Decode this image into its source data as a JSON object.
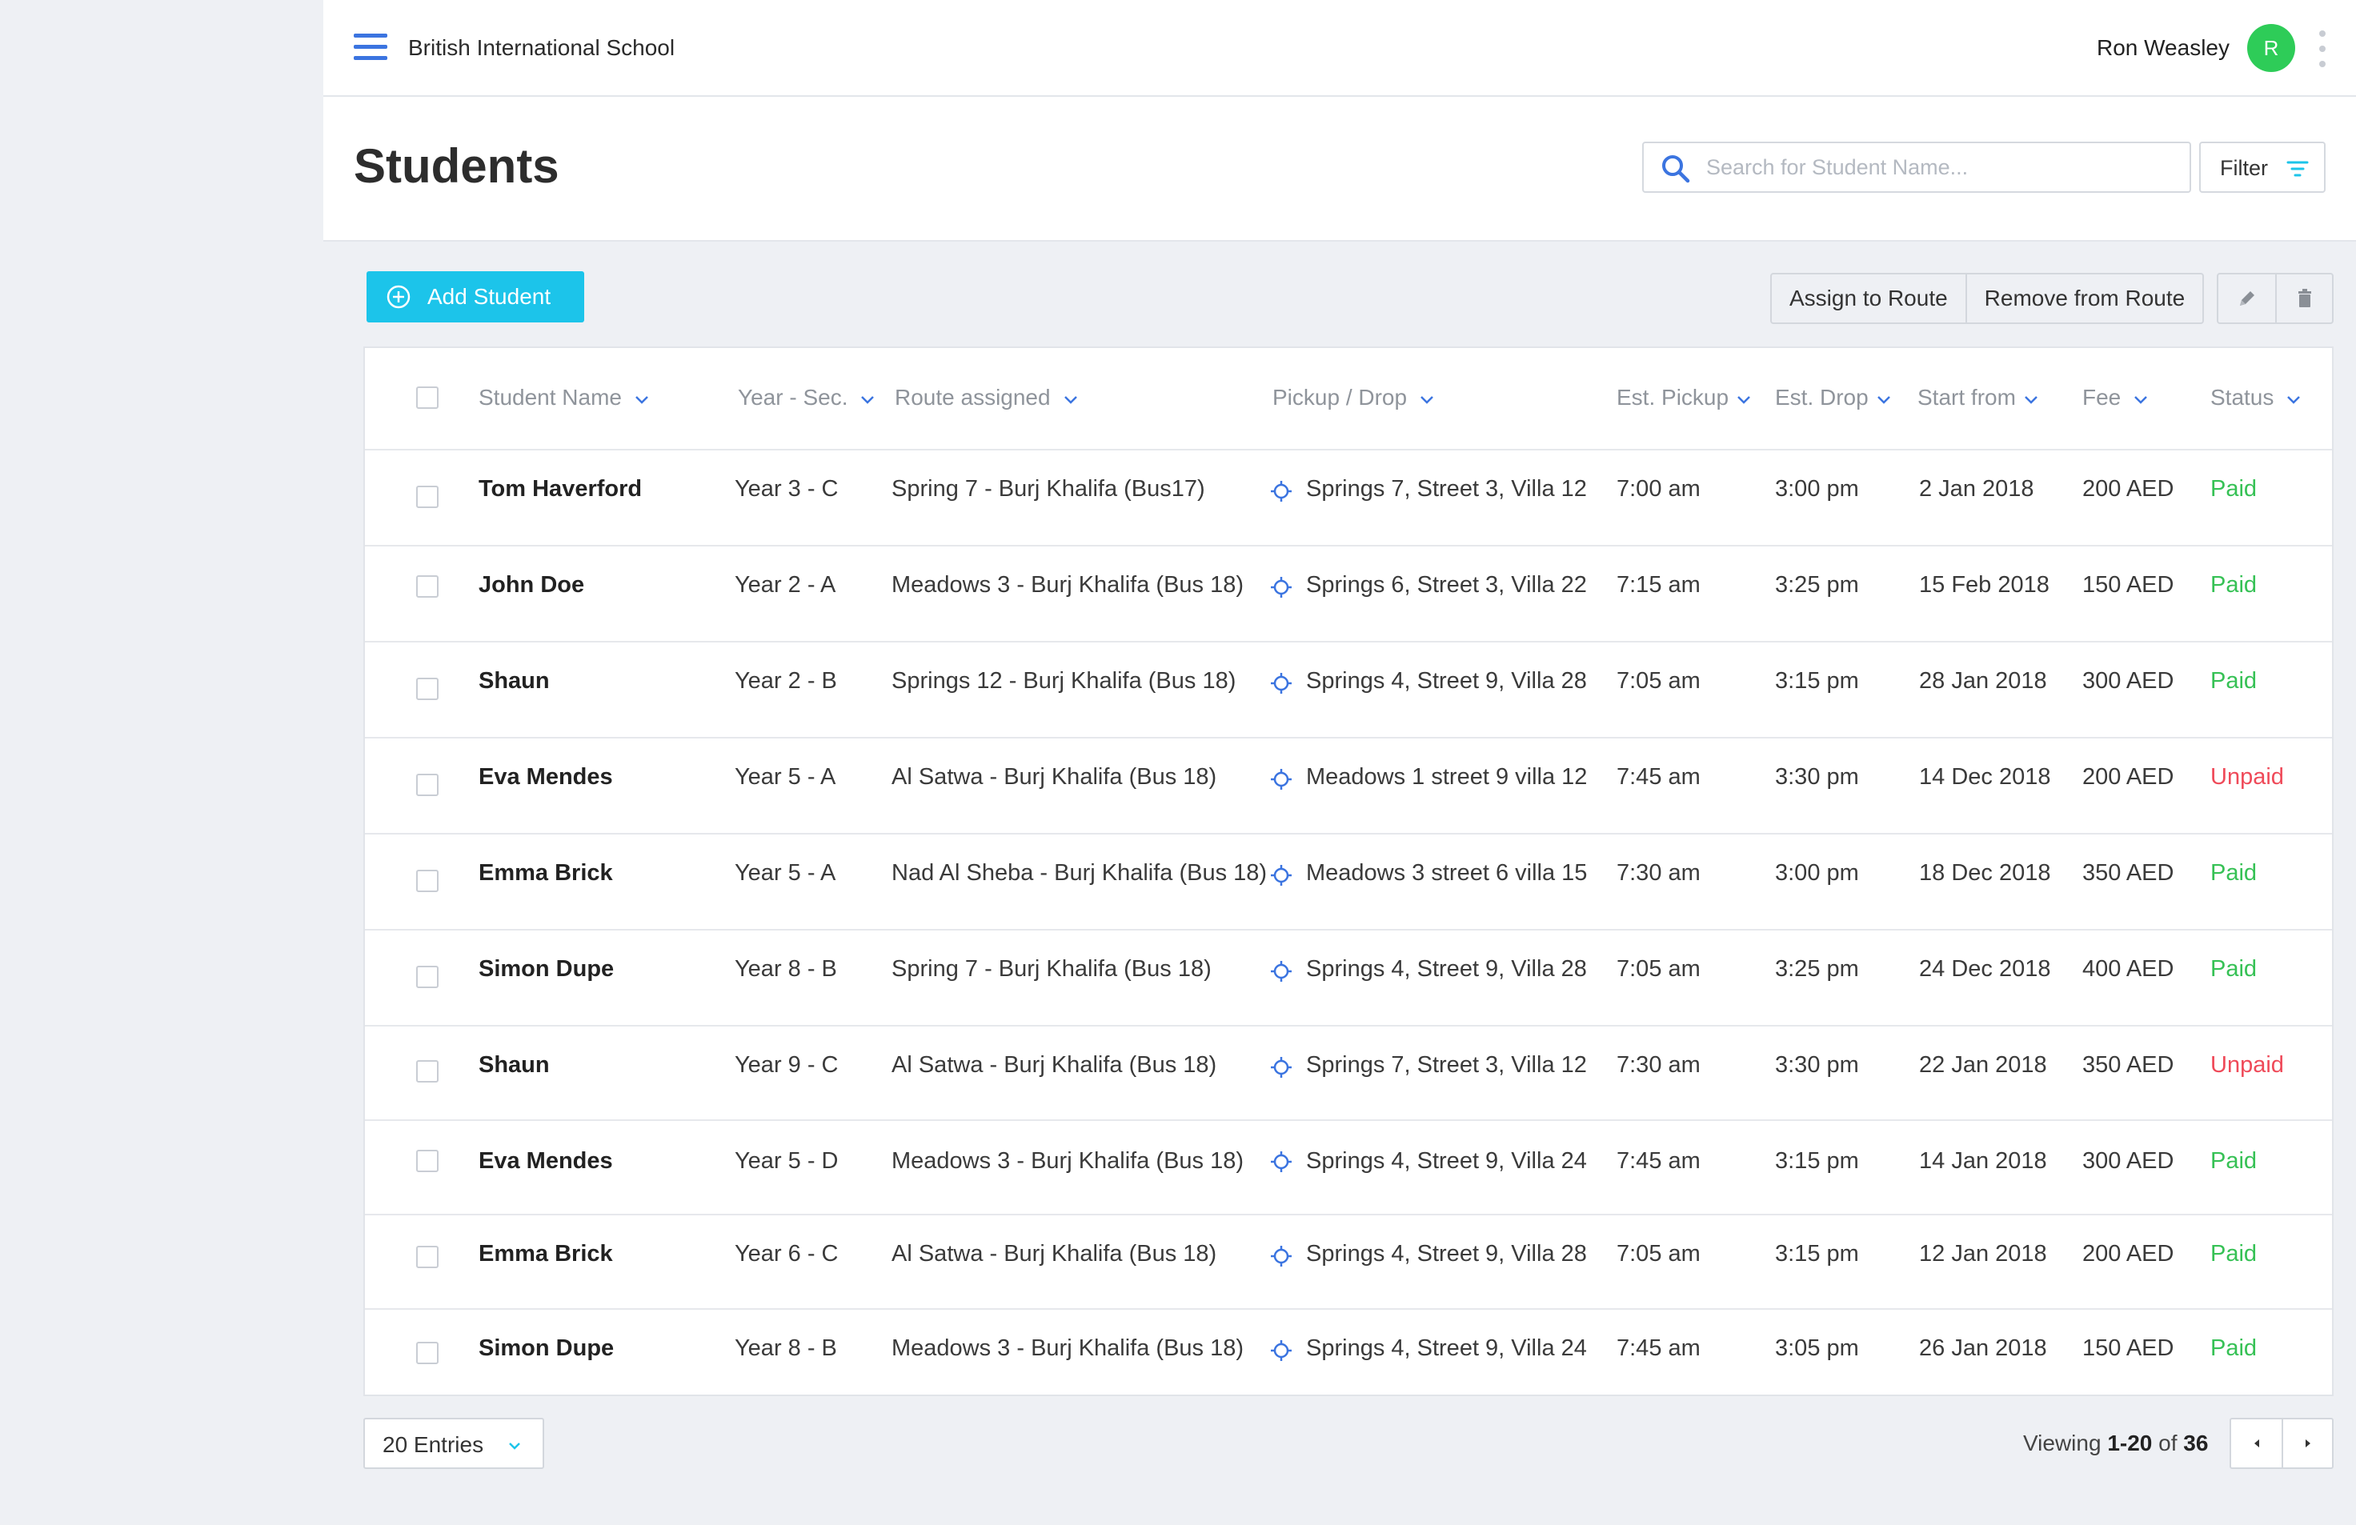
{
  "app": {
    "school_name": "British International School",
    "user_name": "Ron Weasley",
    "user_initial": "R",
    "accent_color": "#3b74e0",
    "avatar_color": "#2ecc58"
  },
  "header": {
    "title": "Students",
    "search_placeholder": "Search for Student Name...",
    "search_value": "",
    "filter_label": "Filter"
  },
  "toolbar": {
    "add_label": "Add Student",
    "add_color": "#1cc4ea",
    "assign_label": "Assign to Route",
    "remove_label": "Remove from Route",
    "edit_icon": "pencil-icon",
    "delete_icon": "trash-icon"
  },
  "table": {
    "columns": [
      "Student Name",
      "Year - Sec.",
      "Route assigned",
      "Pickup / Drop",
      "Est. Pickup",
      "Est. Drop",
      "Start from",
      "Fee",
      "Status"
    ],
    "rows": [
      {
        "name": "Tom Haverford",
        "year": "Year 3 - C",
        "route": "Spring 7 - Burj Khalifa (Bus17)",
        "pickup": "Springs 7, Street 3, Villa 12",
        "est_pickup": "7:00 am",
        "est_drop": "3:00 pm",
        "start": "2 Jan 2018",
        "fee": "200 AED",
        "status": "Paid"
      },
      {
        "name": "John Doe",
        "year": "Year 2 - A",
        "route": "Meadows 3 - Burj Khalifa (Bus 18)",
        "pickup": "Springs 6, Street 3, Villa 22",
        "est_pickup": "7:15 am",
        "est_drop": "3:25 pm",
        "start": "15 Feb 2018",
        "fee": "150 AED",
        "status": "Paid"
      },
      {
        "name": "Shaun",
        "year": "Year 2 - B",
        "route": "Springs 12 - Burj Khalifa (Bus 18)",
        "pickup": "Springs 4, Street 9, Villa 28",
        "est_pickup": "7:05 am",
        "est_drop": "3:15 pm",
        "start": "28 Jan 2018",
        "fee": "300 AED",
        "status": "Paid"
      },
      {
        "name": "Eva Mendes",
        "year": "Year 5 - A",
        "route": "Al Satwa - Burj Khalifa (Bus 18)",
        "pickup": "Meadows 1 street 9 villa 12",
        "est_pickup": "7:45 am",
        "est_drop": "3:30 pm",
        "start": "14 Dec 2018",
        "fee": "200 AED",
        "status": "Unpaid"
      },
      {
        "name": "Emma Brick",
        "year": "Year 5 - A",
        "route": "Nad Al Sheba - Burj Khalifa  (Bus 18)",
        "pickup": "Meadows 3 street 6 villa 15",
        "est_pickup": "7:30 am",
        "est_drop": "3:00 pm",
        "start": "18 Dec 2018",
        "fee": "350 AED",
        "status": "Paid"
      },
      {
        "name": "Simon Dupe",
        "year": "Year 8 - B",
        "route": "Spring 7 - Burj Khalifa  (Bus 18)",
        "pickup": "Springs 4, Street 9, Villa 28",
        "est_pickup": "7:05 am",
        "est_drop": "3:25 pm",
        "start": "24 Dec 2018",
        "fee": "400 AED",
        "status": "Paid"
      },
      {
        "name": "Shaun",
        "year": "Year 9 - C",
        "route": "Al Satwa - Burj Khalifa  (Bus 18)",
        "pickup": "Springs 7, Street 3, Villa 12",
        "est_pickup": "7:30 am",
        "est_drop": "3:30 pm",
        "start": "22 Jan 2018",
        "fee": "350 AED",
        "status": "Unpaid"
      },
      {
        "name": "Eva Mendes",
        "year": "Year 5 - D",
        "route": "Meadows 3 - Burj Khalifa  (Bus 18)",
        "pickup": "Springs 4, Street 9, Villa 24",
        "est_pickup": "7:45 am",
        "est_drop": "3:15 pm",
        "start": "14 Jan 2018",
        "fee": "300 AED",
        "status": "Paid"
      },
      {
        "name": "Emma Brick",
        "year": "Year 6 - C",
        "route": "Al Satwa - Burj Khalifa  (Bus 18)",
        "pickup": "Springs 4, Street 9, Villa 28",
        "est_pickup": "7:05 am",
        "est_drop": "3:15 pm",
        "start": "12 Jan 2018",
        "fee": "200 AED",
        "status": "Paid"
      },
      {
        "name": "Simon Dupe",
        "year": "Year 8 - B",
        "route": "Meadows 3 - Burj Khalifa (Bus 18)",
        "pickup": "Springs 4, Street 9, Villa 24",
        "est_pickup": "7:45 am",
        "est_drop": "3:05 pm",
        "start": "26 Jan 2018",
        "fee": "150 AED",
        "status": "Paid"
      }
    ],
    "status_colors": {
      "Paid": "#36c155",
      "Unpaid": "#ef4a59"
    }
  },
  "footer": {
    "entries_label": "20 Entries",
    "viewing_prefix": "Viewing ",
    "viewing_range": "1-20",
    "viewing_of": " of ",
    "viewing_total": "36"
  }
}
